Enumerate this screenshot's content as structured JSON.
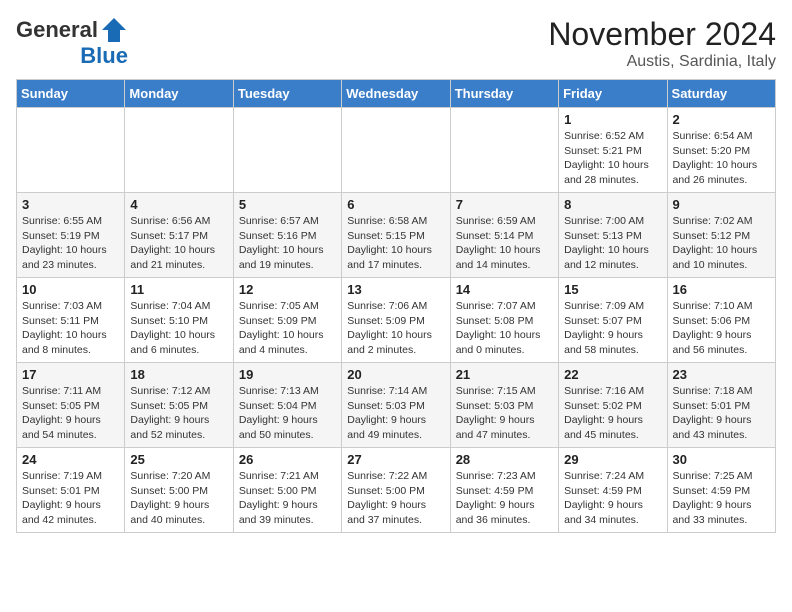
{
  "header": {
    "logo_general": "General",
    "logo_blue": "Blue",
    "month_title": "November 2024",
    "location": "Austis, Sardinia, Italy"
  },
  "weekdays": [
    "Sunday",
    "Monday",
    "Tuesday",
    "Wednesday",
    "Thursday",
    "Friday",
    "Saturday"
  ],
  "weeks": [
    [
      {
        "day": "",
        "detail": ""
      },
      {
        "day": "",
        "detail": ""
      },
      {
        "day": "",
        "detail": ""
      },
      {
        "day": "",
        "detail": ""
      },
      {
        "day": "",
        "detail": ""
      },
      {
        "day": "1",
        "detail": "Sunrise: 6:52 AM\nSunset: 5:21 PM\nDaylight: 10 hours\nand 28 minutes."
      },
      {
        "day": "2",
        "detail": "Sunrise: 6:54 AM\nSunset: 5:20 PM\nDaylight: 10 hours\nand 26 minutes."
      }
    ],
    [
      {
        "day": "3",
        "detail": "Sunrise: 6:55 AM\nSunset: 5:19 PM\nDaylight: 10 hours\nand 23 minutes."
      },
      {
        "day": "4",
        "detail": "Sunrise: 6:56 AM\nSunset: 5:17 PM\nDaylight: 10 hours\nand 21 minutes."
      },
      {
        "day": "5",
        "detail": "Sunrise: 6:57 AM\nSunset: 5:16 PM\nDaylight: 10 hours\nand 19 minutes."
      },
      {
        "day": "6",
        "detail": "Sunrise: 6:58 AM\nSunset: 5:15 PM\nDaylight: 10 hours\nand 17 minutes."
      },
      {
        "day": "7",
        "detail": "Sunrise: 6:59 AM\nSunset: 5:14 PM\nDaylight: 10 hours\nand 14 minutes."
      },
      {
        "day": "8",
        "detail": "Sunrise: 7:00 AM\nSunset: 5:13 PM\nDaylight: 10 hours\nand 12 minutes."
      },
      {
        "day": "9",
        "detail": "Sunrise: 7:02 AM\nSunset: 5:12 PM\nDaylight: 10 hours\nand 10 minutes."
      }
    ],
    [
      {
        "day": "10",
        "detail": "Sunrise: 7:03 AM\nSunset: 5:11 PM\nDaylight: 10 hours\nand 8 minutes."
      },
      {
        "day": "11",
        "detail": "Sunrise: 7:04 AM\nSunset: 5:10 PM\nDaylight: 10 hours\nand 6 minutes."
      },
      {
        "day": "12",
        "detail": "Sunrise: 7:05 AM\nSunset: 5:09 PM\nDaylight: 10 hours\nand 4 minutes."
      },
      {
        "day": "13",
        "detail": "Sunrise: 7:06 AM\nSunset: 5:09 PM\nDaylight: 10 hours\nand 2 minutes."
      },
      {
        "day": "14",
        "detail": "Sunrise: 7:07 AM\nSunset: 5:08 PM\nDaylight: 10 hours\nand 0 minutes."
      },
      {
        "day": "15",
        "detail": "Sunrise: 7:09 AM\nSunset: 5:07 PM\nDaylight: 9 hours\nand 58 minutes."
      },
      {
        "day": "16",
        "detail": "Sunrise: 7:10 AM\nSunset: 5:06 PM\nDaylight: 9 hours\nand 56 minutes."
      }
    ],
    [
      {
        "day": "17",
        "detail": "Sunrise: 7:11 AM\nSunset: 5:05 PM\nDaylight: 9 hours\nand 54 minutes."
      },
      {
        "day": "18",
        "detail": "Sunrise: 7:12 AM\nSunset: 5:05 PM\nDaylight: 9 hours\nand 52 minutes."
      },
      {
        "day": "19",
        "detail": "Sunrise: 7:13 AM\nSunset: 5:04 PM\nDaylight: 9 hours\nand 50 minutes."
      },
      {
        "day": "20",
        "detail": "Sunrise: 7:14 AM\nSunset: 5:03 PM\nDaylight: 9 hours\nand 49 minutes."
      },
      {
        "day": "21",
        "detail": "Sunrise: 7:15 AM\nSunset: 5:03 PM\nDaylight: 9 hours\nand 47 minutes."
      },
      {
        "day": "22",
        "detail": "Sunrise: 7:16 AM\nSunset: 5:02 PM\nDaylight: 9 hours\nand 45 minutes."
      },
      {
        "day": "23",
        "detail": "Sunrise: 7:18 AM\nSunset: 5:01 PM\nDaylight: 9 hours\nand 43 minutes."
      }
    ],
    [
      {
        "day": "24",
        "detail": "Sunrise: 7:19 AM\nSunset: 5:01 PM\nDaylight: 9 hours\nand 42 minutes."
      },
      {
        "day": "25",
        "detail": "Sunrise: 7:20 AM\nSunset: 5:00 PM\nDaylight: 9 hours\nand 40 minutes."
      },
      {
        "day": "26",
        "detail": "Sunrise: 7:21 AM\nSunset: 5:00 PM\nDaylight: 9 hours\nand 39 minutes."
      },
      {
        "day": "27",
        "detail": "Sunrise: 7:22 AM\nSunset: 5:00 PM\nDaylight: 9 hours\nand 37 minutes."
      },
      {
        "day": "28",
        "detail": "Sunrise: 7:23 AM\nSunset: 4:59 PM\nDaylight: 9 hours\nand 36 minutes."
      },
      {
        "day": "29",
        "detail": "Sunrise: 7:24 AM\nSunset: 4:59 PM\nDaylight: 9 hours\nand 34 minutes."
      },
      {
        "day": "30",
        "detail": "Sunrise: 7:25 AM\nSunset: 4:59 PM\nDaylight: 9 hours\nand 33 minutes."
      }
    ]
  ]
}
